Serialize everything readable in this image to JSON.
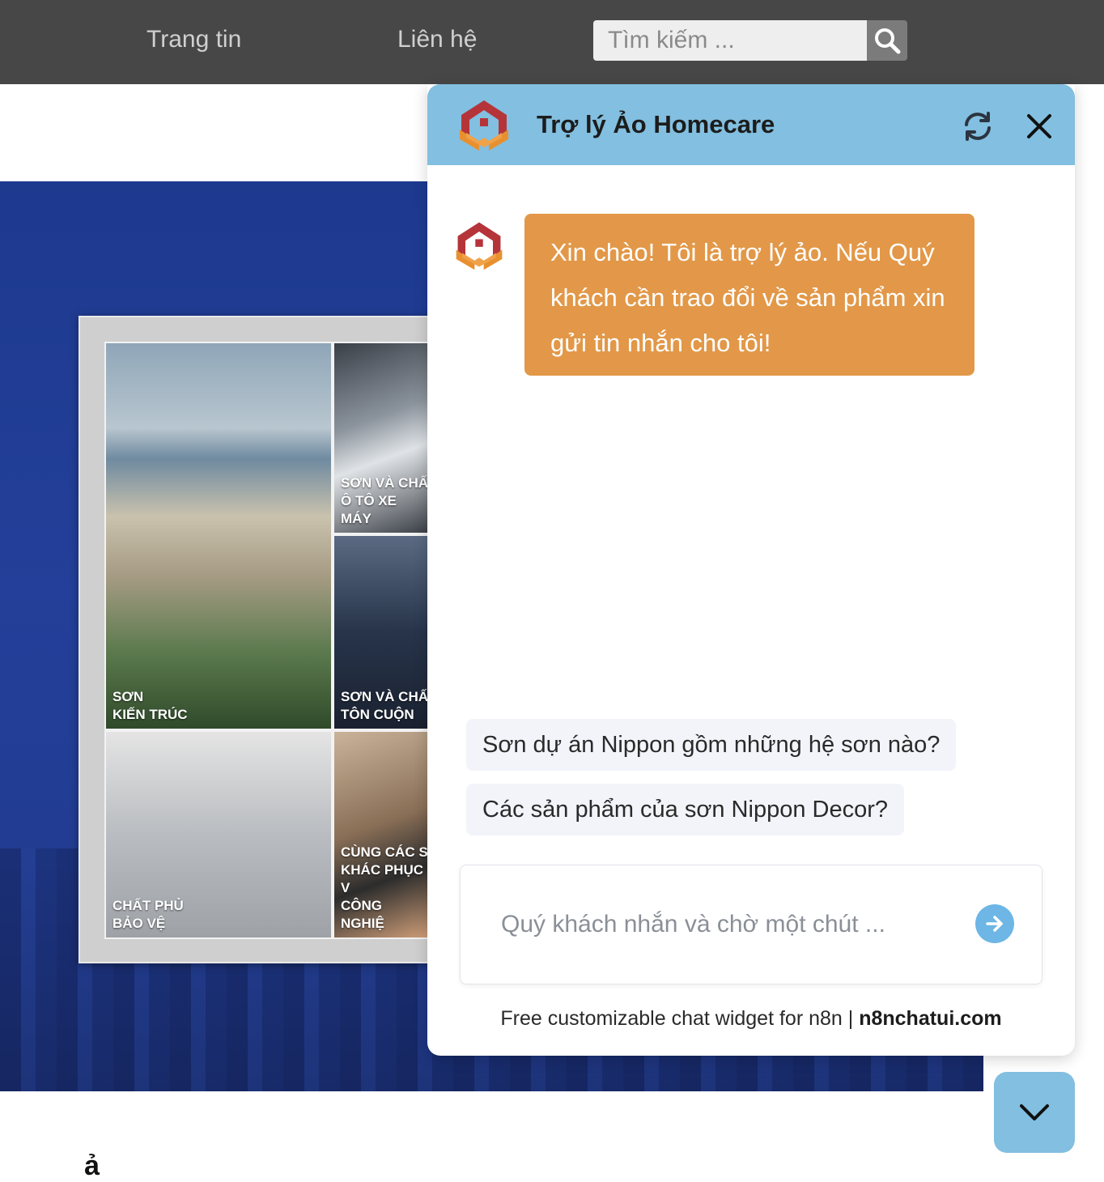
{
  "nav": {
    "links": [
      "Trang tin",
      "Liên hệ"
    ],
    "search_placeholder": "Tìm kiếm ..."
  },
  "hero": {
    "tiles": [
      "SƠN\nKIẾN TRÚC",
      "SƠN VÀ CHẤ\nÔ TÔ XE MÁY",
      "SƠN VÀ CHẤ\nTÔN CUỘN",
      "CHẤT PHỦ\nBẢO VỆ",
      "CÙNG CÁC S\nKHÁC PHỤC V\nCÔNG NGHIỆ"
    ]
  },
  "chat": {
    "title": "Trợ lý Ảo Homecare",
    "welcome": "Xin chào! Tôi là trợ lý ảo. Nếu Quý khách cần trao đổi về sản phẩm xin gửi tin nhắn cho tôi!",
    "suggestions": [
      "Sơn dự án Nippon gồm những hệ sơn nào?",
      "Các sản phẩm của sơn Nippon Decor?"
    ],
    "input_placeholder": "Quý khách nhắn và chờ một chút ...",
    "footer_text": "Free customizable chat widget for n8n | ",
    "footer_link": "n8nchatui.com"
  },
  "bottom_partial_text": "ả",
  "colors": {
    "nav_bg": "#474747",
    "chat_header": "#82bfe0",
    "bot_bubble": "#e29848",
    "send_button": "#6db6e5",
    "hero_bg": "#233f99"
  },
  "icons": [
    "search-icon",
    "homecare-logo-icon",
    "refresh-icon",
    "close-icon",
    "arrow-right-icon",
    "chevron-down-icon"
  ]
}
